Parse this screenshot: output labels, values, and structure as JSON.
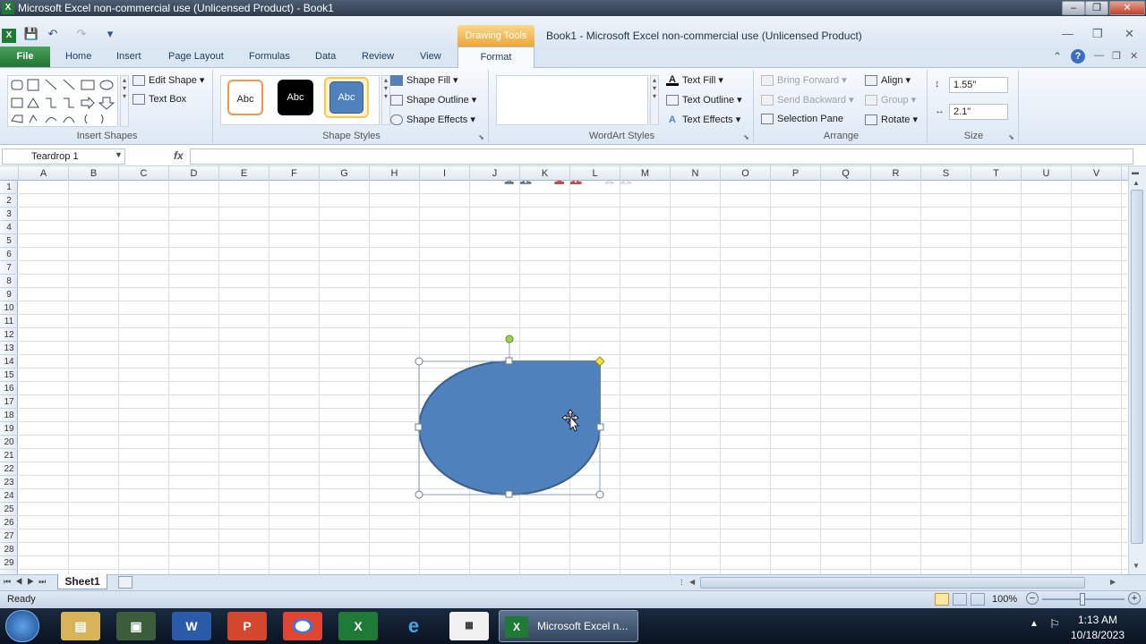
{
  "window": {
    "title": "Microsoft Excel non-commercial use (Unlicensed Product) - Book1",
    "context_title": "Book1  -  Microsoft Excel non-commercial use (Unlicensed Product)",
    "contextual_tab_group": "Drawing Tools"
  },
  "tabs": [
    "File",
    "Home",
    "Insert",
    "Page Layout",
    "Formulas",
    "Data",
    "Review",
    "View",
    "Format"
  ],
  "ribbon": {
    "insert_shapes": {
      "label": "Insert Shapes",
      "edit_shape": "Edit Shape",
      "text_box": "Text Box"
    },
    "shape_styles": {
      "label": "Shape Styles",
      "sample": "Abc",
      "shape_fill": "Shape Fill",
      "shape_outline": "Shape Outline",
      "shape_effects": "Shape Effects"
    },
    "wordart_styles": {
      "label": "WordArt Styles",
      "sample": "A",
      "text_fill": "Text Fill",
      "text_outline": "Text Outline",
      "text_effects": "Text Effects"
    },
    "arrange": {
      "label": "Arrange",
      "bring_forward": "Bring Forward",
      "send_backward": "Send Backward",
      "selection_pane": "Selection Pane",
      "align": "Align",
      "group": "Group",
      "rotate": "Rotate"
    },
    "size": {
      "label": "Size",
      "height": "1.55\"",
      "width": "2.1\""
    }
  },
  "formula_bar": {
    "name_box": "Teardrop 1",
    "fx": "fx",
    "value": ""
  },
  "columns": [
    "A",
    "B",
    "C",
    "D",
    "E",
    "F",
    "G",
    "H",
    "I",
    "J",
    "K",
    "L",
    "M",
    "N",
    "O",
    "P",
    "Q",
    "R",
    "S",
    "T",
    "U",
    "V"
  ],
  "rows": [
    "1",
    "2",
    "3",
    "4",
    "5",
    "6",
    "7",
    "8",
    "9",
    "10",
    "11",
    "12",
    "13",
    "14",
    "15",
    "16",
    "17",
    "18",
    "19",
    "20",
    "21",
    "22",
    "23",
    "24",
    "25",
    "26",
    "27",
    "28",
    "29"
  ],
  "sheet_tab": "Sheet1",
  "status": {
    "ready": "Ready",
    "zoom": "100%"
  },
  "shape": {
    "fill": "#4f81bd",
    "outline": "#3a5f8d"
  },
  "taskbar": {
    "active_app": "Microsoft Excel n...",
    "time": "1:13 AM",
    "date": "10/18/2023"
  },
  "colors": {
    "file_tab": "#2a8a3d",
    "drawing_tools": "#f0b040",
    "accent": "#4f81bd"
  }
}
